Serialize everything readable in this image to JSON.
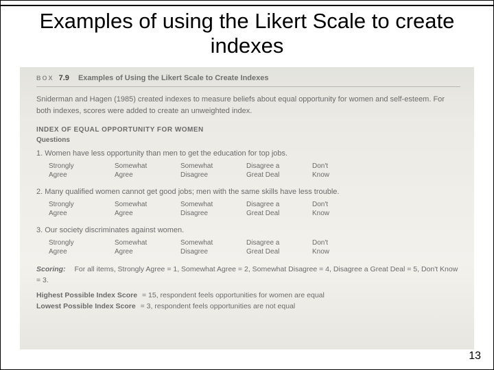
{
  "slide": {
    "title": "Examples of using the Likert Scale to create indexes",
    "page_number": "13"
  },
  "box": {
    "label": "BOX",
    "number": "7.9",
    "title": "Examples of Using the Likert Scale to Create Indexes",
    "intro": "Sniderman and Hagen (1985) created indexes to measure beliefs about equal opportunity for women and self-esteem. For both indexes, scores were added to create an unweighted index.",
    "section_heading": "INDEX OF EQUAL OPPORTUNITY FOR WOMEN",
    "questions_label": "Questions",
    "questions": [
      {
        "num": "1.",
        "text": "Women have less opportunity than men to get the education for top jobs."
      },
      {
        "num": "2.",
        "text": "Many qualified women cannot get good jobs; men with the same skills have less trouble."
      },
      {
        "num": "3.",
        "text": "Our society discriminates against women."
      }
    ],
    "options": [
      {
        "l1": "Strongly",
        "l2": "Agree"
      },
      {
        "l1": "Somewhat",
        "l2": "Agree"
      },
      {
        "l1": "Somewhat",
        "l2": "Disagree"
      },
      {
        "l1": "Disagree a",
        "l2": "Great Deal"
      },
      {
        "l1": "Don't",
        "l2": "Know"
      }
    ],
    "scoring_label": "Scoring:",
    "scoring_text": "For all items, Strongly Agree = 1, Somewhat Agree = 2, Somewhat Disagree = 4, Disagree a Great Deal = 5, Don't Know = 3.",
    "highest_label": "Highest Possible Index Score",
    "highest_text": " = 15, respondent feels opportunities for women are equal",
    "lowest_label": "Lowest Possible Index Score",
    "lowest_text": " = 3, respondent feels opportunities are not equal"
  }
}
